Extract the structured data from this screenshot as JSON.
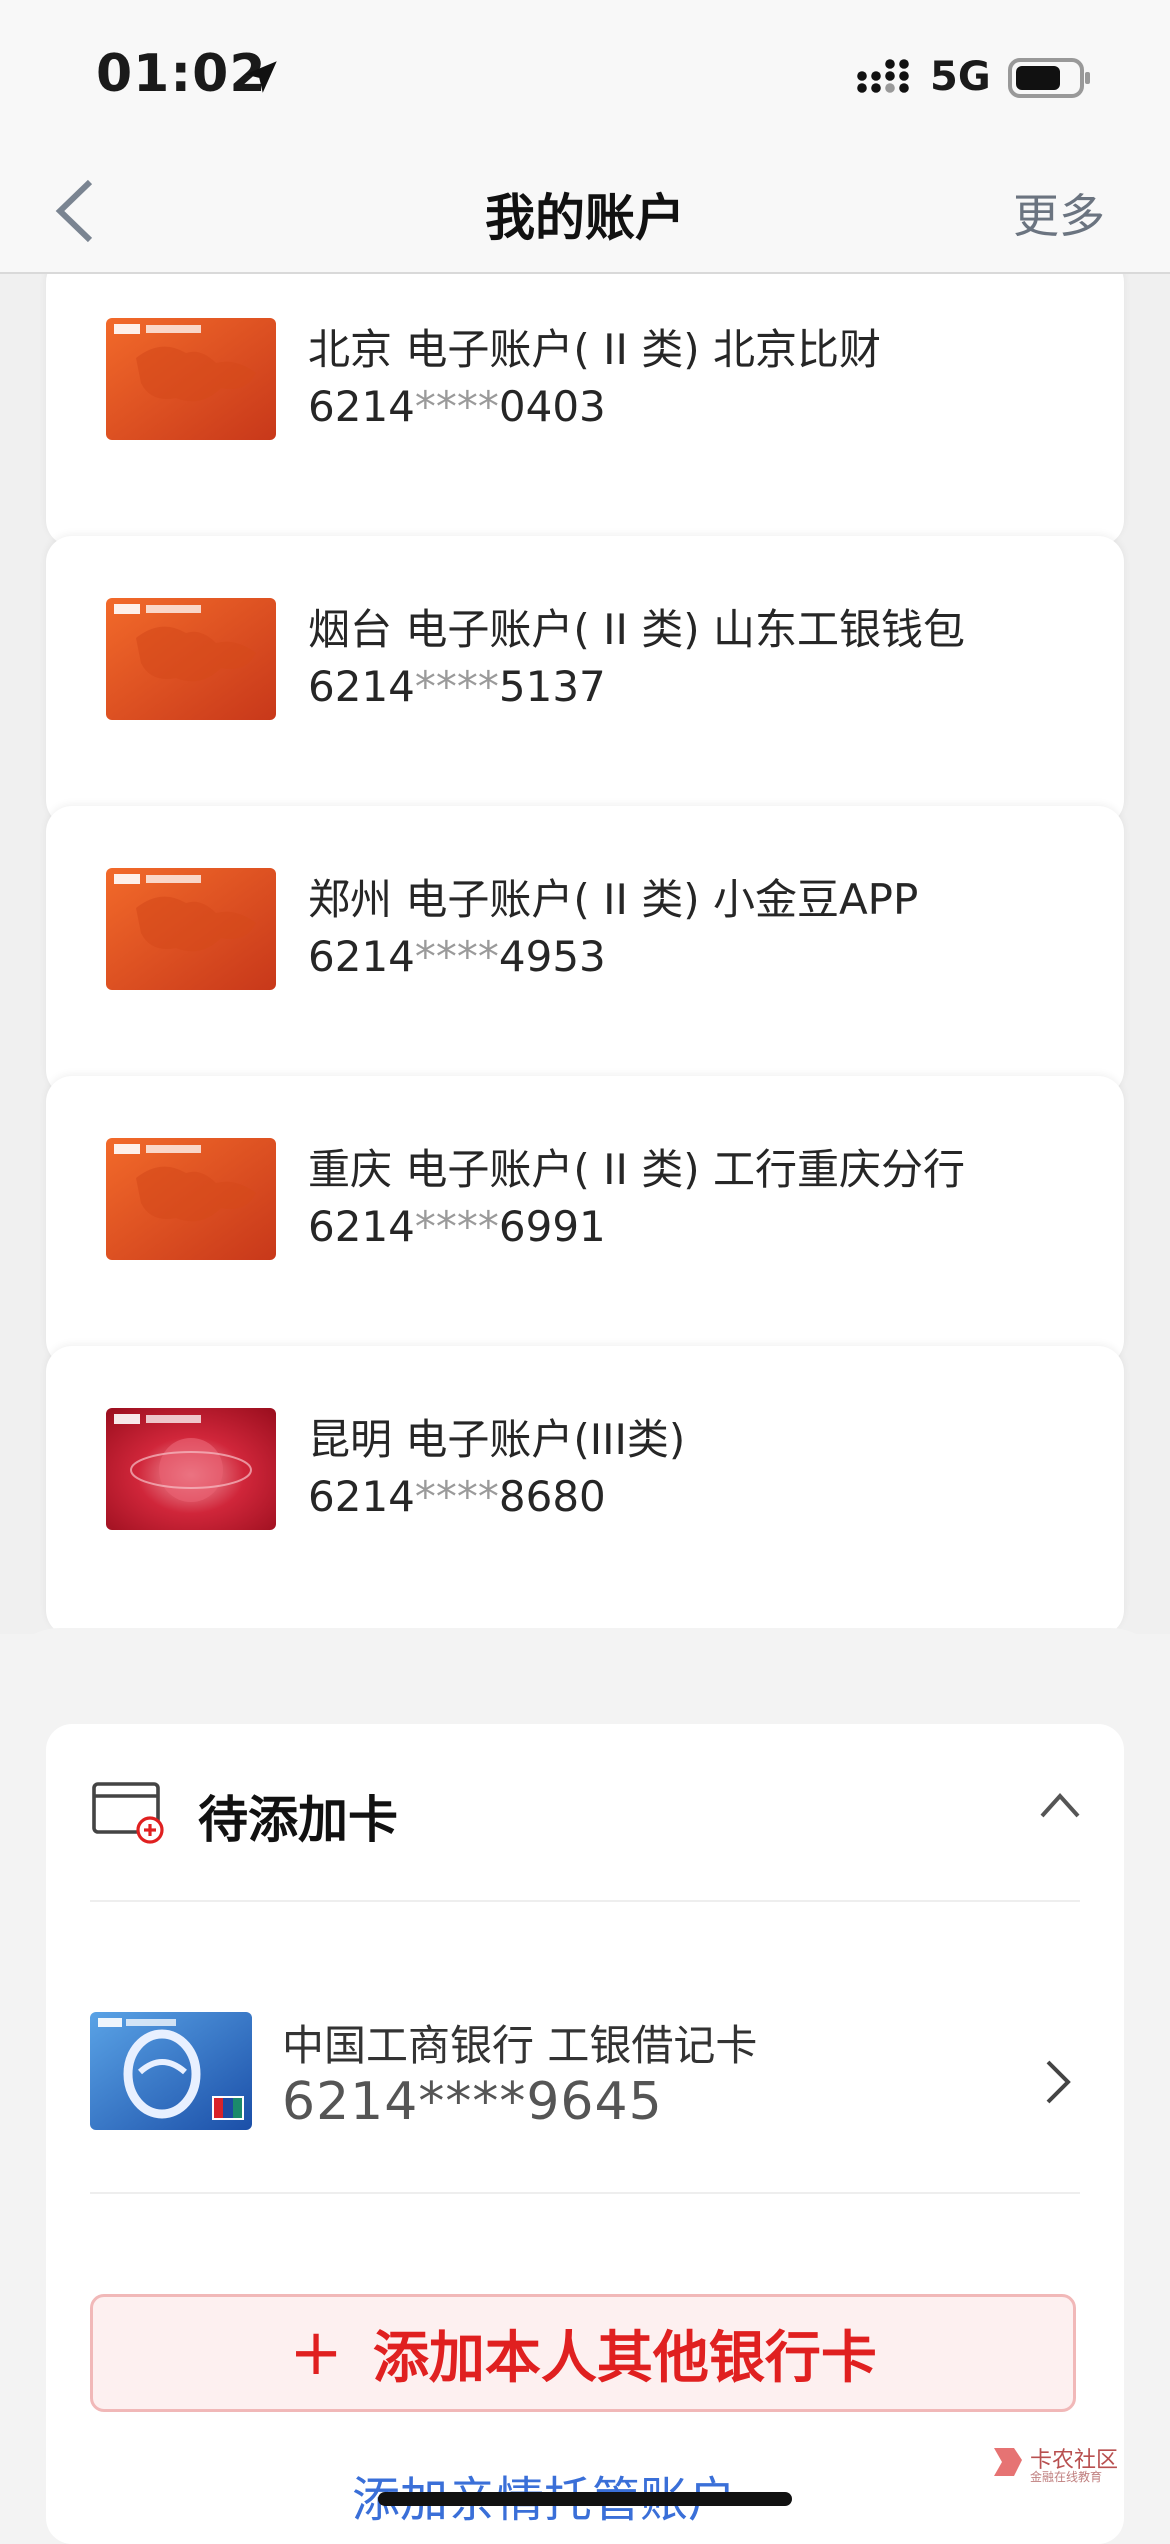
{
  "status_bar": {
    "time": "01:02",
    "network": "5G"
  },
  "nav": {
    "title": "我的账户",
    "more_label": "更多"
  },
  "accounts": [
    {
      "title": "北京  电子账户( II 类)  北京比财",
      "prefix": "6214",
      "mask": "****",
      "suffix": "0403",
      "card_style": "orange"
    },
    {
      "title": "烟台  电子账户( II 类)  山东工银钱包",
      "prefix": "6214",
      "mask": "****",
      "suffix": "5137",
      "card_style": "orange"
    },
    {
      "title": "郑州  电子账户( II 类)  小金豆APP",
      "prefix": "6214",
      "mask": "****",
      "suffix": "4953",
      "card_style": "orange"
    },
    {
      "title": "重庆  电子账户( II 类)  工行重庆分行",
      "prefix": "6214",
      "mask": "****",
      "suffix": "6991",
      "card_style": "orange"
    },
    {
      "title": "昆明  电子账户(III类)",
      "prefix": "6214",
      "mask": "****",
      "suffix": "8680",
      "card_style": "red"
    }
  ],
  "pending": {
    "title": "待添加卡",
    "card": {
      "bank": "中国工商银行  工银借记卡",
      "number": "6214****9645",
      "style": "blue"
    }
  },
  "add_button": {
    "plus": "+",
    "label": "添加本人其他银行卡"
  },
  "family_link": "添加亲情托管账户",
  "watermark": {
    "name": "卡农社区",
    "tagline": "金融在线教育"
  },
  "colors": {
    "accent_red": "#e02020",
    "link_blue": "#3a6fd8",
    "icbc_orange": "#e8501a"
  }
}
